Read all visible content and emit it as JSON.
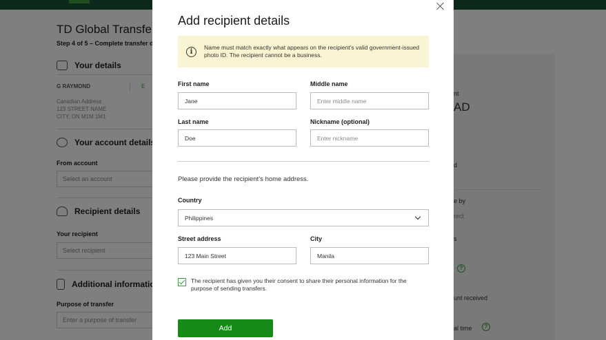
{
  "background": {
    "page_title": "TD Global Transfer",
    "step_text": "Step 4 of 5 – Complete transfer de",
    "your_details": {
      "heading": "Your details",
      "name": "G RAYMOND",
      "edit_label": "E",
      "address": "Canadian Address\n123 STREET NAME\nCITY, ON M1M 1M1"
    },
    "account_details": {
      "heading": "Your account details",
      "from_account_label": "From account",
      "from_account_placeholder": "Select an account"
    },
    "recipient_details": {
      "heading": "Recipient details",
      "your_recipient_label": "Your recipient",
      "your_recipient_placeholder": "Select recipient"
    },
    "additional_info": {
      "heading": "Additional informatio",
      "purpose_label": "Purpose of transfer",
      "purpose_placeholder": "Enter a purpose of transfer"
    },
    "right_panel": {
      "t1": "nt",
      "t2": "AD",
      "t3": "d",
      "t4": "e by",
      "t5": "rect",
      "t6": "s",
      "t7": "unt received",
      "t8": "al time",
      "help": "?"
    }
  },
  "modal": {
    "title": "Add recipient details",
    "notice": "Name must match exactly what appears on the recipient’s valid government-issued photo ID. The recipient cannot be a business.",
    "info_glyph": "i",
    "first_name": {
      "label": "First name",
      "value": "Jane"
    },
    "middle_name": {
      "label": "Middle name",
      "placeholder": "Enter middle name"
    },
    "last_name": {
      "label": "Last name",
      "value": "Doe"
    },
    "nickname": {
      "label": "Nickname (optional)",
      "placeholder": "Enter nickname"
    },
    "address_prompt": "Please provide the recipient’s home address.",
    "country": {
      "label": "Country",
      "value": "Philippines"
    },
    "street": {
      "label": "Street address",
      "value": "123 Main Street"
    },
    "city": {
      "label": "City",
      "value": "Manila"
    },
    "consent": "The recipient has given you their consent to share their personal information for the purpose of sending transfers.",
    "add_label": "Add"
  },
  "colors": {
    "brand_dark": "#1a5336",
    "brand_green": "#168a16",
    "notice_bg": "#fbf4d2"
  }
}
